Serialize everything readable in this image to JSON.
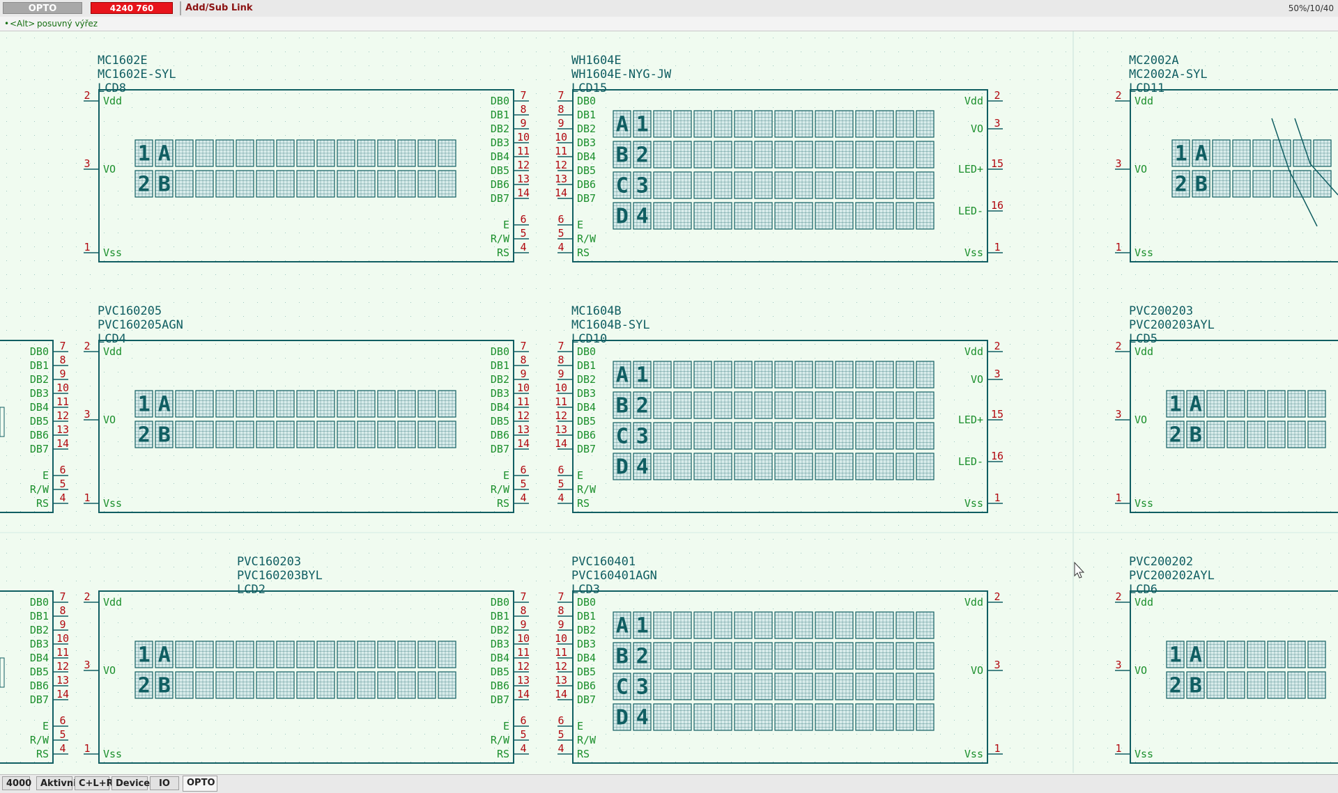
{
  "toolbar": {
    "layer": "OPTO",
    "coords": "4240    760",
    "mode": "Add/Sub Link",
    "zoom": "50%/10/40"
  },
  "hint": {
    "bullet": "•",
    "key": "<Alt>",
    "text": "posuvný výřez"
  },
  "tabs": [
    "4000",
    "Aktivni",
    "C+L+R",
    "Device",
    "IO",
    "OPTO"
  ],
  "active_tab": "OPTO",
  "colors": {
    "schematic": "#105e62",
    "pin_number": "#b1080f",
    "pin_name": "#1b8f2c",
    "canvas": "#f0fbf0"
  },
  "components": [
    {
      "name1": "MC1602E",
      "name2": "MC1602E-SYL",
      "ref": "LCD8",
      "left_pins": [
        [
          "2",
          "Vdd"
        ],
        [
          "3",
          "VO"
        ],
        [
          "1",
          "Vss"
        ]
      ],
      "right_pins": [
        [
          "7",
          "DB0"
        ],
        [
          "8",
          "DB1"
        ],
        [
          "9",
          "DB2"
        ],
        [
          "10",
          "DB3"
        ],
        [
          "11",
          "DB4"
        ],
        [
          "12",
          "DB5"
        ],
        [
          "13",
          "DB6"
        ],
        [
          "14",
          "DB7"
        ],
        [
          "6",
          "E"
        ],
        [
          "5",
          "R/W"
        ],
        [
          "4",
          "RS"
        ]
      ],
      "rows": [
        "1A",
        "2B"
      ]
    },
    {
      "name1": "WH1604E",
      "name2": "WH1604E-NYG-JW",
      "ref": "LCD15",
      "left_pins": [
        [
          "7",
          "DB0"
        ],
        [
          "8",
          "DB1"
        ],
        [
          "9",
          "DB2"
        ],
        [
          "10",
          "DB3"
        ],
        [
          "11",
          "DB4"
        ],
        [
          "12",
          "DB5"
        ],
        [
          "13",
          "DB6"
        ],
        [
          "14",
          "DB7"
        ],
        [
          "6",
          "E"
        ],
        [
          "5",
          "R/W"
        ],
        [
          "4",
          "RS"
        ]
      ],
      "right_pins": [
        [
          "2",
          "Vdd"
        ],
        [
          "3",
          "VO"
        ],
        [
          "15",
          "LED+"
        ],
        [
          "16",
          "LED-"
        ],
        [
          "1",
          "Vss"
        ]
      ],
      "rows": [
        "A1",
        "B2",
        "C3",
        "D4"
      ]
    },
    {
      "name1": "MC2002A",
      "name2": "MC2002A-SYL",
      "ref": "LCD11",
      "left_pins": [
        [
          "2",
          "Vdd"
        ],
        [
          "3",
          "VO"
        ],
        [
          "1",
          "Vss"
        ]
      ],
      "right_pins": [],
      "rows": [
        "1A",
        "2B"
      ]
    },
    {
      "name1": "PVC160205",
      "name2": "PVC160205AGN",
      "ref": "LCD4",
      "left_pins": [
        [
          "2",
          "Vdd"
        ],
        [
          "3",
          "VO"
        ],
        [
          "1",
          "Vss"
        ]
      ],
      "right_pins": [
        [
          "7",
          "DB0"
        ],
        [
          "8",
          "DB1"
        ],
        [
          "9",
          "DB2"
        ],
        [
          "10",
          "DB3"
        ],
        [
          "11",
          "DB4"
        ],
        [
          "12",
          "DB5"
        ],
        [
          "13",
          "DB6"
        ],
        [
          "14",
          "DB7"
        ],
        [
          "6",
          "E"
        ],
        [
          "5",
          "R/W"
        ],
        [
          "4",
          "RS"
        ]
      ],
      "rows": [
        "1A",
        "2B"
      ]
    },
    {
      "name1": "MC1604B",
      "name2": "MC1604B-SYL",
      "ref": "LCD10",
      "left_pins": [
        [
          "7",
          "DB0"
        ],
        [
          "8",
          "DB1"
        ],
        [
          "9",
          "DB2"
        ],
        [
          "10",
          "DB3"
        ],
        [
          "11",
          "DB4"
        ],
        [
          "12",
          "DB5"
        ],
        [
          "13",
          "DB6"
        ],
        [
          "14",
          "DB7"
        ],
        [
          "6",
          "E"
        ],
        [
          "5",
          "R/W"
        ],
        [
          "4",
          "RS"
        ]
      ],
      "right_pins": [
        [
          "2",
          "Vdd"
        ],
        [
          "3",
          "VO"
        ],
        [
          "15",
          "LED+"
        ],
        [
          "16",
          "LED-"
        ],
        [
          "1",
          "Vss"
        ]
      ],
      "rows": [
        "A1",
        "B2",
        "C3",
        "D4"
      ]
    },
    {
      "name1": "PVC200203",
      "name2": "PVC200203AYL",
      "ref": "LCD5",
      "left_pins": [
        [
          "2",
          "Vdd"
        ],
        [
          "3",
          "VO"
        ],
        [
          "1",
          "Vss"
        ]
      ],
      "right_pins": [],
      "rows": [
        "1A",
        "2B"
      ]
    },
    {
      "name1": "PVC160203",
      "name2": "PVC160203BYL",
      "ref": "LCD2",
      "left_pins": [
        [
          "2",
          "Vdd"
        ],
        [
          "3",
          "VO"
        ],
        [
          "1",
          "Vss"
        ]
      ],
      "right_pins": [
        [
          "7",
          "DB0"
        ],
        [
          "8",
          "DB1"
        ],
        [
          "9",
          "DB2"
        ],
        [
          "10",
          "DB3"
        ],
        [
          "11",
          "DB4"
        ],
        [
          "12",
          "DB5"
        ],
        [
          "13",
          "DB6"
        ],
        [
          "14",
          "DB7"
        ],
        [
          "6",
          "E"
        ],
        [
          "5",
          "R/W"
        ],
        [
          "4",
          "RS"
        ]
      ],
      "rows": [
        "1A",
        "2B"
      ]
    },
    {
      "name1": "PVC160401",
      "name2": "PVC160401AGN",
      "ref": "LCD3",
      "left_pins": [
        [
          "7",
          "DB0"
        ],
        [
          "8",
          "DB1"
        ],
        [
          "9",
          "DB2"
        ],
        [
          "10",
          "DB3"
        ],
        [
          "11",
          "DB4"
        ],
        [
          "12",
          "DB5"
        ],
        [
          "13",
          "DB6"
        ],
        [
          "14",
          "DB7"
        ],
        [
          "6",
          "E"
        ],
        [
          "5",
          "R/W"
        ],
        [
          "4",
          "RS"
        ]
      ],
      "right_pins": [
        [
          "2",
          "Vdd"
        ],
        [
          "3",
          "VO"
        ],
        [
          "1",
          "Vss"
        ]
      ],
      "rows": [
        "A1",
        "B2",
        "C3",
        "D4"
      ]
    },
    {
      "name1": "PVC200202",
      "name2": "PVC200202AYL",
      "ref": "LCD6",
      "left_pins": [
        [
          "2",
          "Vdd"
        ],
        [
          "3",
          "VO"
        ],
        [
          "1",
          "Vss"
        ]
      ],
      "right_pins": [],
      "rows": [
        "1A",
        "2B"
      ]
    }
  ],
  "partial_left": {
    "pins": [
      [
        "7",
        "DB0"
      ],
      [
        "8",
        "DB1"
      ],
      [
        "9",
        "DB2"
      ],
      [
        "10",
        "DB3"
      ],
      [
        "11",
        "DB4"
      ],
      [
        "12",
        "DB5"
      ],
      [
        "13",
        "DB6"
      ],
      [
        "14",
        "DB7"
      ],
      [
        "6",
        "E"
      ],
      [
        "5",
        "R/W"
      ],
      [
        "4",
        "RS"
      ]
    ]
  }
}
